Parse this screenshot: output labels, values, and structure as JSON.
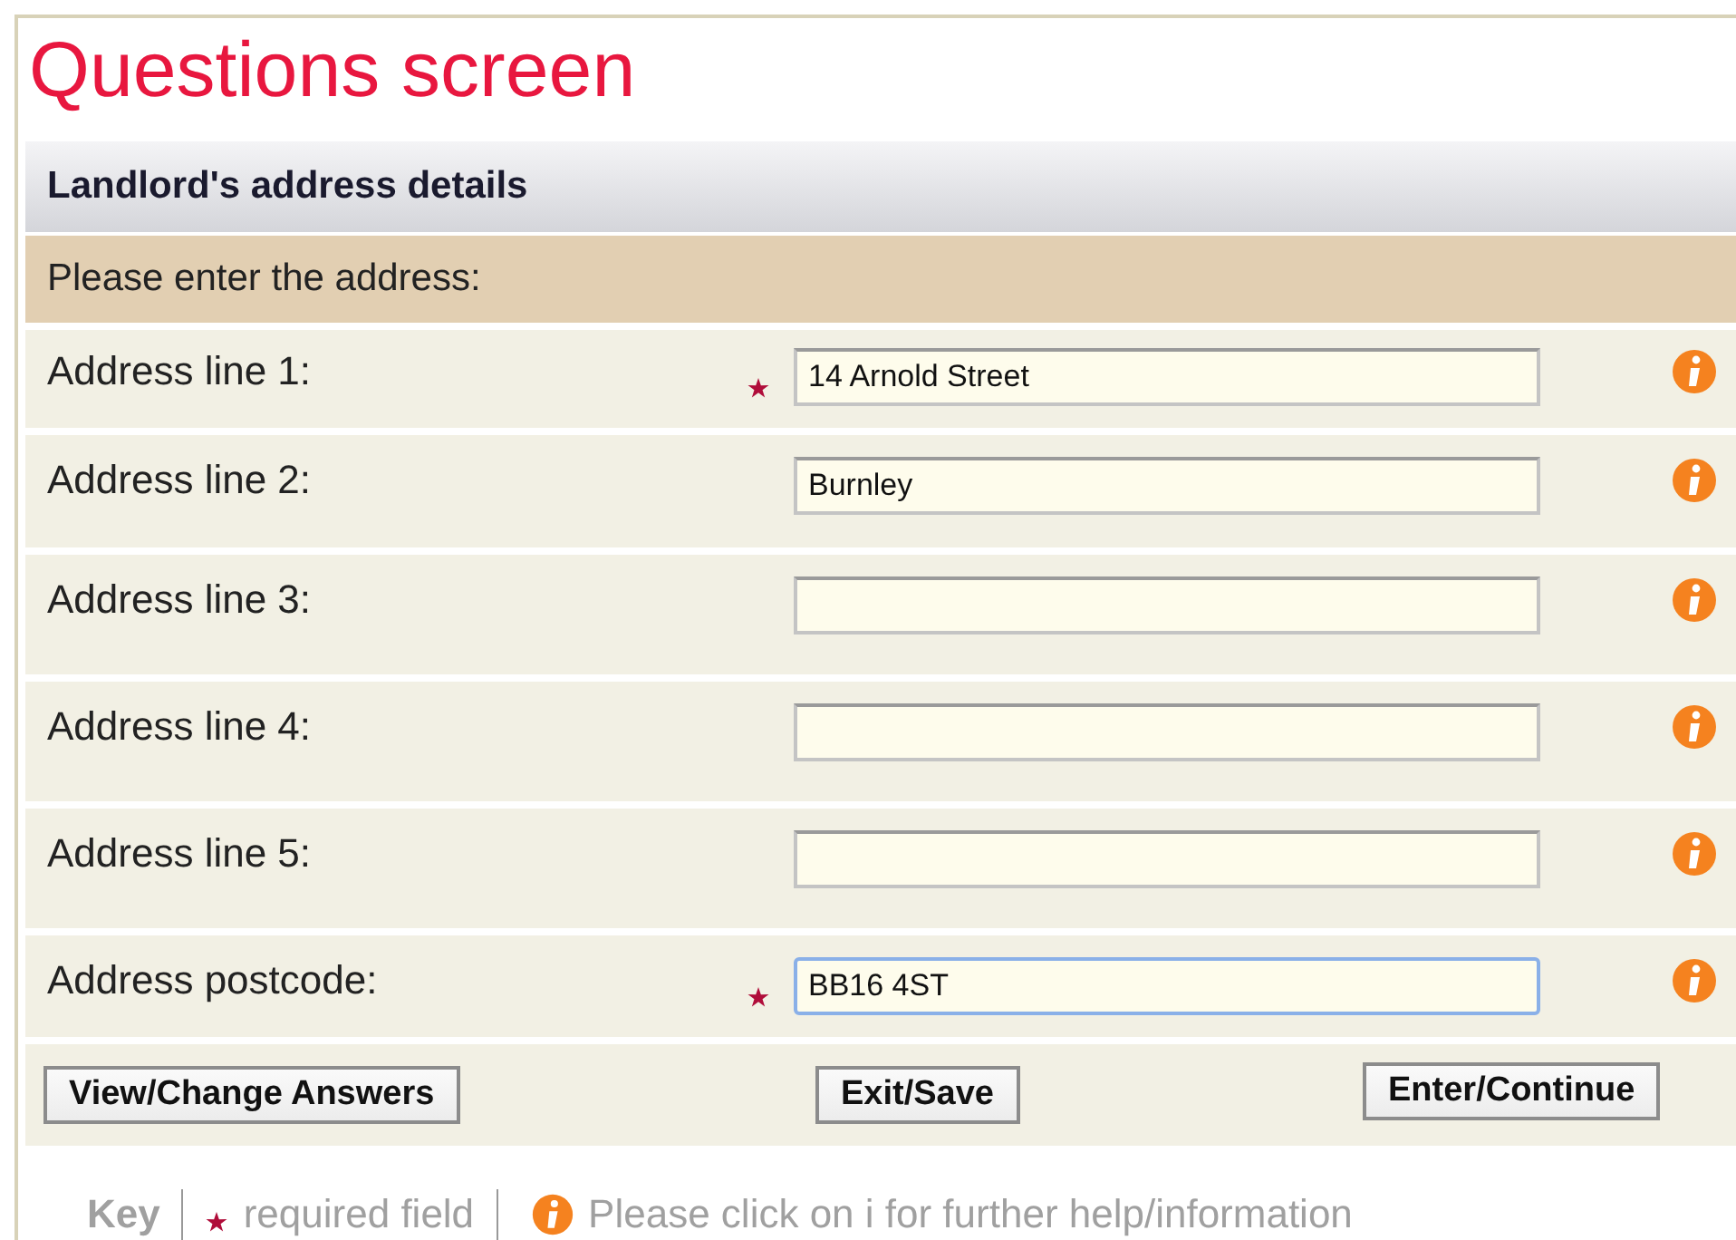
{
  "title": "Questions screen",
  "section": {
    "heading": "Landlord's address details",
    "prompt": "Please enter the address:"
  },
  "fields": [
    {
      "label": "Address line 1:",
      "value": "14 Arnold Street",
      "required": true,
      "focused": false
    },
    {
      "label": "Address line 2:",
      "value": "Burnley",
      "required": false,
      "focused": false
    },
    {
      "label": "Address line 3:",
      "required": false,
      "focused": false
    },
    {
      "label": "Address line 4:",
      "required": false,
      "focused": false
    },
    {
      "label": "Address line 5:",
      "required": false,
      "focused": false
    },
    {
      "label": "Address postcode:",
      "value": "BB16 4ST",
      "required": true,
      "focused": true
    }
  ],
  "buttons": [
    "View/Change Answers",
    "Exit/Save",
    "Enter/Continue"
  ],
  "key": {
    "title": "Key",
    "required": "required field",
    "help": "Please click on i for further help/information"
  }
}
